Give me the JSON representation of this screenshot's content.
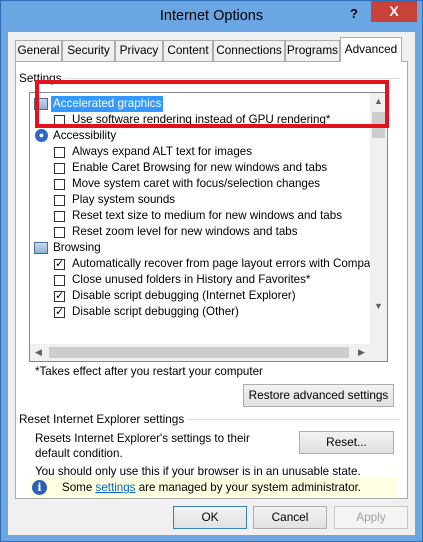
{
  "window": {
    "title": "Internet Options",
    "help_glyph": "?",
    "close_glyph": "X"
  },
  "tabs": [
    {
      "label": "General",
      "active": false
    },
    {
      "label": "Security",
      "active": false
    },
    {
      "label": "Privacy",
      "active": false
    },
    {
      "label": "Content",
      "active": false
    },
    {
      "label": "Connections",
      "active": false
    },
    {
      "label": "Programs",
      "active": false
    },
    {
      "label": "Advanced",
      "active": true
    }
  ],
  "settings": {
    "group_label": "Settings",
    "items": [
      {
        "kind": "category",
        "label": "Accelerated graphics",
        "icon": "category-icon",
        "selected": true
      },
      {
        "kind": "checkbox",
        "label": "Use software rendering instead of GPU rendering*",
        "checked": false
      },
      {
        "kind": "category",
        "label": "Accessibility",
        "icon": "accessibility-icon",
        "selected": false
      },
      {
        "kind": "checkbox",
        "label": "Always expand ALT text for images",
        "checked": false
      },
      {
        "kind": "checkbox",
        "label": "Enable Caret Browsing for new windows and tabs",
        "checked": false
      },
      {
        "kind": "checkbox",
        "label": "Move system caret with focus/selection changes",
        "checked": false
      },
      {
        "kind": "checkbox",
        "label": "Play system sounds",
        "checked": false
      },
      {
        "kind": "checkbox",
        "label": "Reset text size to medium for new windows and tabs",
        "checked": false
      },
      {
        "kind": "checkbox",
        "label": "Reset zoom level for new windows and tabs",
        "checked": false
      },
      {
        "kind": "category",
        "label": "Browsing",
        "icon": "category-icon",
        "selected": false
      },
      {
        "kind": "checkbox",
        "label": "Automatically recover from page layout errors with Compa",
        "checked": true
      },
      {
        "kind": "checkbox",
        "label": "Close unused folders in History and Favorites*",
        "checked": false
      },
      {
        "kind": "checkbox",
        "label": "Disable script debugging (Internet Explorer)",
        "checked": true
      },
      {
        "kind": "checkbox",
        "label": "Disable script debugging (Other)",
        "checked": true
      }
    ],
    "footnote": "*Takes effect after you restart your computer",
    "restore_button": "Restore advanced settings"
  },
  "reset": {
    "group_label": "Reset Internet Explorer settings",
    "description": "Resets Internet Explorer's settings to their default condition.",
    "reset_button": "Reset...",
    "warning": "You should only use this if your browser is in an unusable state."
  },
  "info_bar": {
    "prefix": "Some ",
    "link": "settings",
    "suffix": " are managed by your system administrator."
  },
  "footer": {
    "ok": "OK",
    "cancel": "Cancel",
    "apply": "Apply"
  },
  "colors": {
    "titlebar": "#6aa6e3",
    "close_button": "#c7433a",
    "selection": "#3399ff",
    "highlight_box": "#e2111b",
    "info_bar": "#ffffe1"
  }
}
